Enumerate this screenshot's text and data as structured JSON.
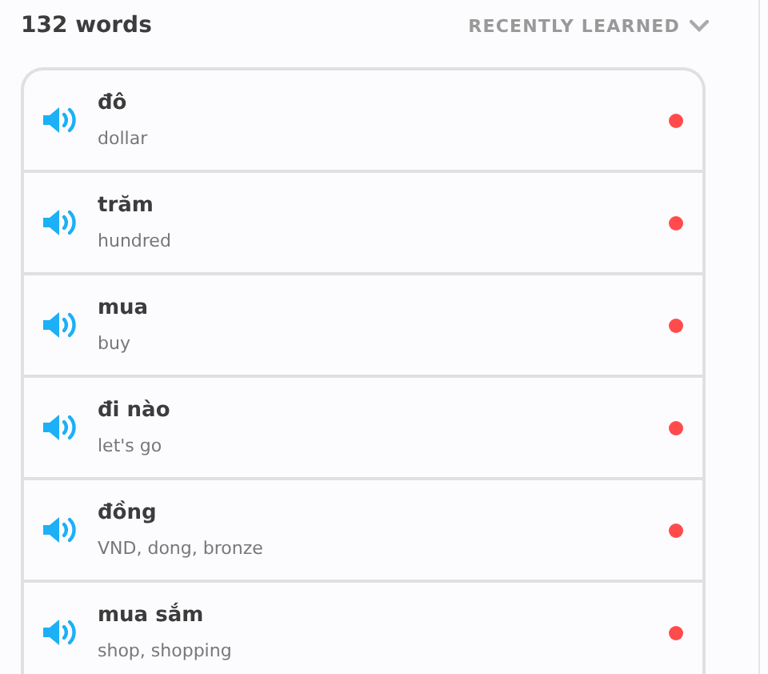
{
  "header": {
    "count": "132 words",
    "sort": "RECENTLY LEARNED"
  },
  "words": [
    {
      "word": "đô",
      "translation": "dollar",
      "color": "#ff4b4b"
    },
    {
      "word": "trăm",
      "translation": "hundred",
      "color": "#ff4b4b"
    },
    {
      "word": "mua",
      "translation": "buy",
      "color": "#ff4b4b"
    },
    {
      "word": "đi nào",
      "translation": "let's go",
      "color": "#ff4b4b"
    },
    {
      "word": "đồng",
      "translation": "VND, dong, bronze",
      "color": "#ff4b4b"
    },
    {
      "word": "mua sắm",
      "translation": "shop, shopping",
      "color": "#ff4b4b"
    }
  ]
}
